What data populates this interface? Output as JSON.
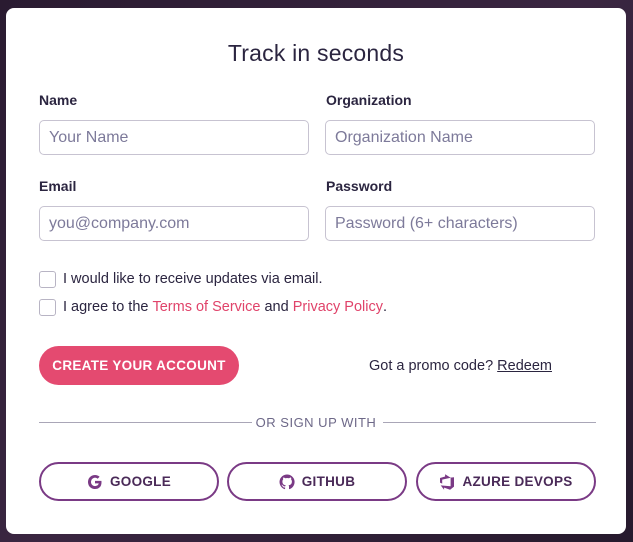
{
  "form": {
    "title": "Track in seconds",
    "name_label": "Name",
    "name_placeholder": "Your Name",
    "org_label": "Organization",
    "org_placeholder": "Organization Name",
    "email_label": "Email",
    "email_placeholder": "you@company.com",
    "password_label": "Password",
    "password_placeholder": "Password (6+ characters)",
    "updates_text": "I would like to receive updates via email.",
    "agree_prefix": "I agree to the ",
    "terms_link": "Terms of Service",
    "agree_middle": " and ",
    "privacy_link": "Privacy Policy",
    "agree_suffix": ".",
    "create_button": "CREATE YOUR ACCOUNT",
    "promo_text": "Got a promo code? ",
    "redeem_link": "Redeem",
    "divider_text": "OR SIGN UP WITH"
  },
  "sso": {
    "google": "GOOGLE",
    "github": "GITHUB",
    "azure": "AZURE DEVOPS",
    "icons": [
      "google-icon",
      "github-icon",
      "azure-devops-icon"
    ]
  },
  "colors": {
    "accent": "#e44a70",
    "link": "#e0436a",
    "sso_border": "#7a3a85",
    "text": "#2b2540",
    "background": "#2b1e33"
  }
}
